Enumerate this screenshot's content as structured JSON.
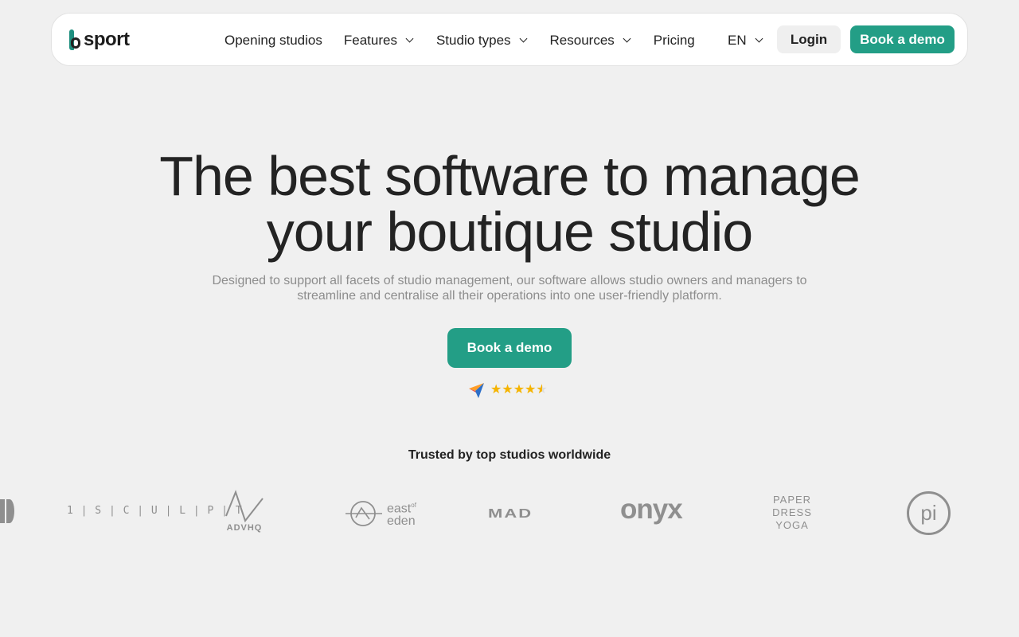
{
  "header": {
    "brand": "sport",
    "nav": [
      {
        "label": "Opening studios",
        "has_dropdown": false
      },
      {
        "label": "Features",
        "has_dropdown": true
      },
      {
        "label": "Studio types",
        "has_dropdown": true
      },
      {
        "label": "Resources",
        "has_dropdown": true
      },
      {
        "label": "Pricing",
        "has_dropdown": false
      }
    ],
    "language": "EN",
    "login_label": "Login",
    "demo_label": "Book a demo"
  },
  "hero": {
    "title_line1": "The best software to manage",
    "title_line2": "your boutique studio",
    "subtitle_line1": "Designed to support all facets of studio management, our software allows studio owners and managers to",
    "subtitle_line2": "streamline and centralise all their operations into one user-friendly platform.",
    "cta_label": "Book a demo",
    "rating_stars": 4.5
  },
  "trusted": {
    "heading": "Trusted by top studios worldwide",
    "logos": [
      {
        "name": "1 | S | C | U | L | P | T"
      },
      {
        "name": "ADVHQ"
      },
      {
        "name": "east",
        "name2": "of",
        "name3": "eden"
      },
      {
        "name": "MAD"
      },
      {
        "name": "onyx"
      },
      {
        "name": "PAPER",
        "name2": "DRESS",
        "name3": "YOGA"
      },
      {
        "name": "pi"
      }
    ]
  },
  "colors": {
    "accent": "#239e86",
    "background": "#f0f0f0",
    "star": "#f5b400",
    "logo_grey": "#8f8f8f"
  }
}
